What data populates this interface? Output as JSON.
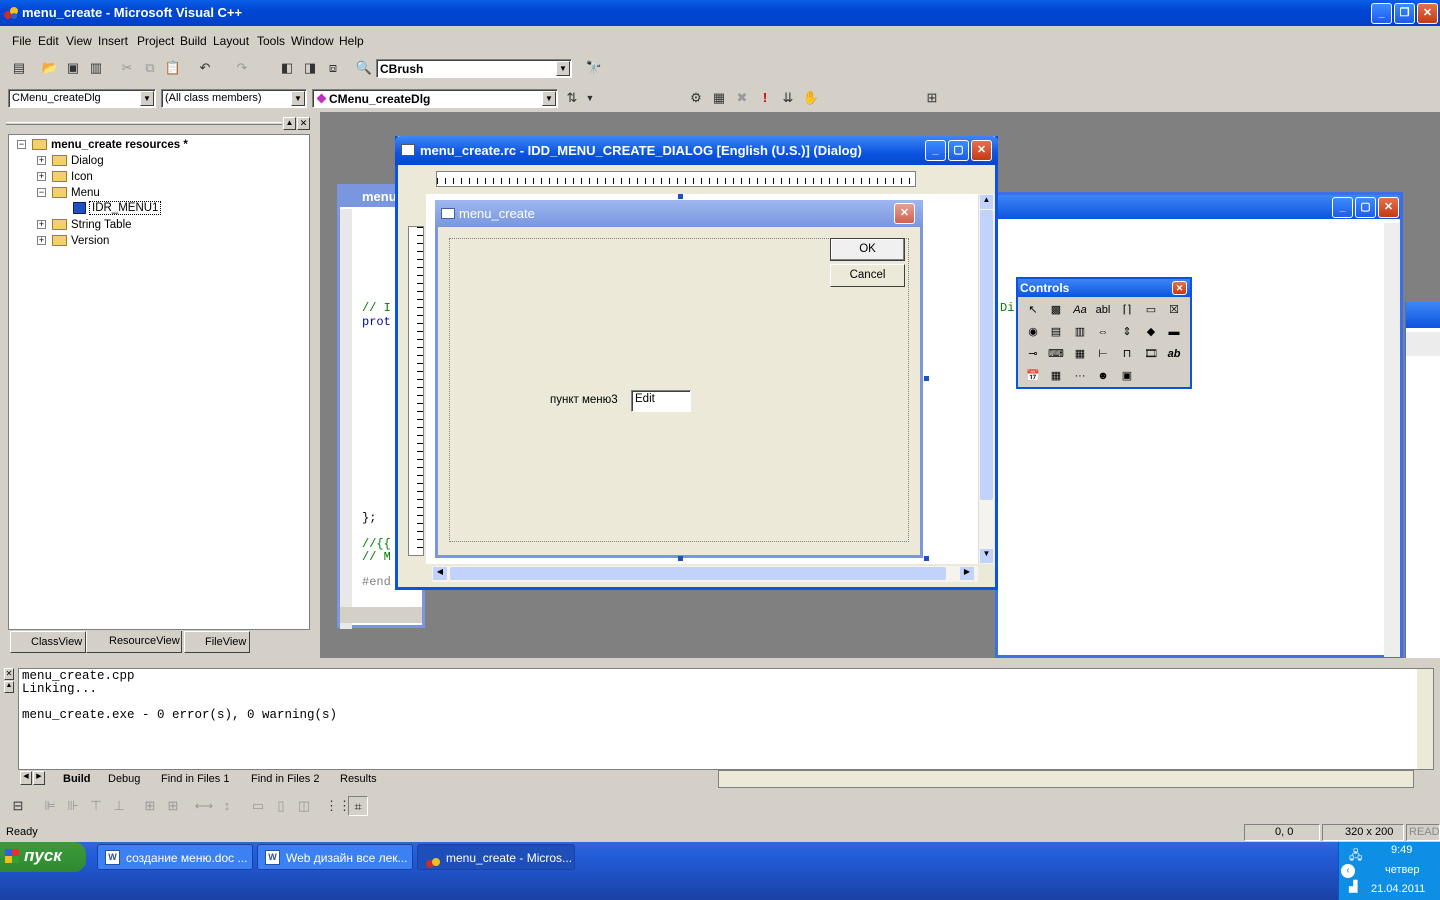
{
  "app": {
    "title": "menu_create - Microsoft Visual C++"
  },
  "menu": [
    "File",
    "Edit",
    "View",
    "Insert",
    "Project",
    "Build",
    "Layout",
    "Tools",
    "Window",
    "Help"
  ],
  "toolbar": {
    "find_combo": "CBrush"
  },
  "wizardbar": {
    "class_combo": "CMenu_createDlg",
    "filter_combo": "(All class members)",
    "member_combo": "CMenu_createDlg"
  },
  "resource_tree": {
    "root": "menu_create resources *",
    "items": [
      "Dialog",
      "Icon",
      "Menu",
      "IDR_MENU1",
      "String Table",
      "Version"
    ]
  },
  "workspace_tabs": [
    "ClassView",
    "ResourceView",
    "FileView"
  ],
  "code_window": {
    "title": "menu",
    "lines": [
      "// I",
      "prot",
      "};",
      "//{{",
      "// M",
      "#end"
    ]
  },
  "right_editor": {
    "fragment": "Di"
  },
  "rc_window": {
    "title": "menu_create.rc - IDD_MENU_CREATE_DIALOG [English (U.S.)] (Dialog)"
  },
  "dialog": {
    "title": "menu_create",
    "ok": "OK",
    "cancel": "Cancel",
    "label": "пункт меню3",
    "edit": "Edit"
  },
  "controls": {
    "title": "Controls"
  },
  "output": {
    "lines": [
      "menu_create.cpp",
      "Linking...",
      "",
      "menu_create.exe - 0 error(s), 0 warning(s)"
    ],
    "tabs": [
      "Build",
      "Debug",
      "Find in Files 1",
      "Find in Files 2",
      "Results"
    ]
  },
  "status": {
    "ready": "Ready",
    "pos": "0, 0",
    "size": "320 x 200",
    "mode": "READ"
  },
  "taskbar": {
    "start": "пуск",
    "tasks": [
      "создание меню.doc ...",
      "Web дизайн все лек...",
      "menu_create - Micros..."
    ],
    "time": "9:49",
    "day": "четвер",
    "date": "21.04.2011"
  }
}
